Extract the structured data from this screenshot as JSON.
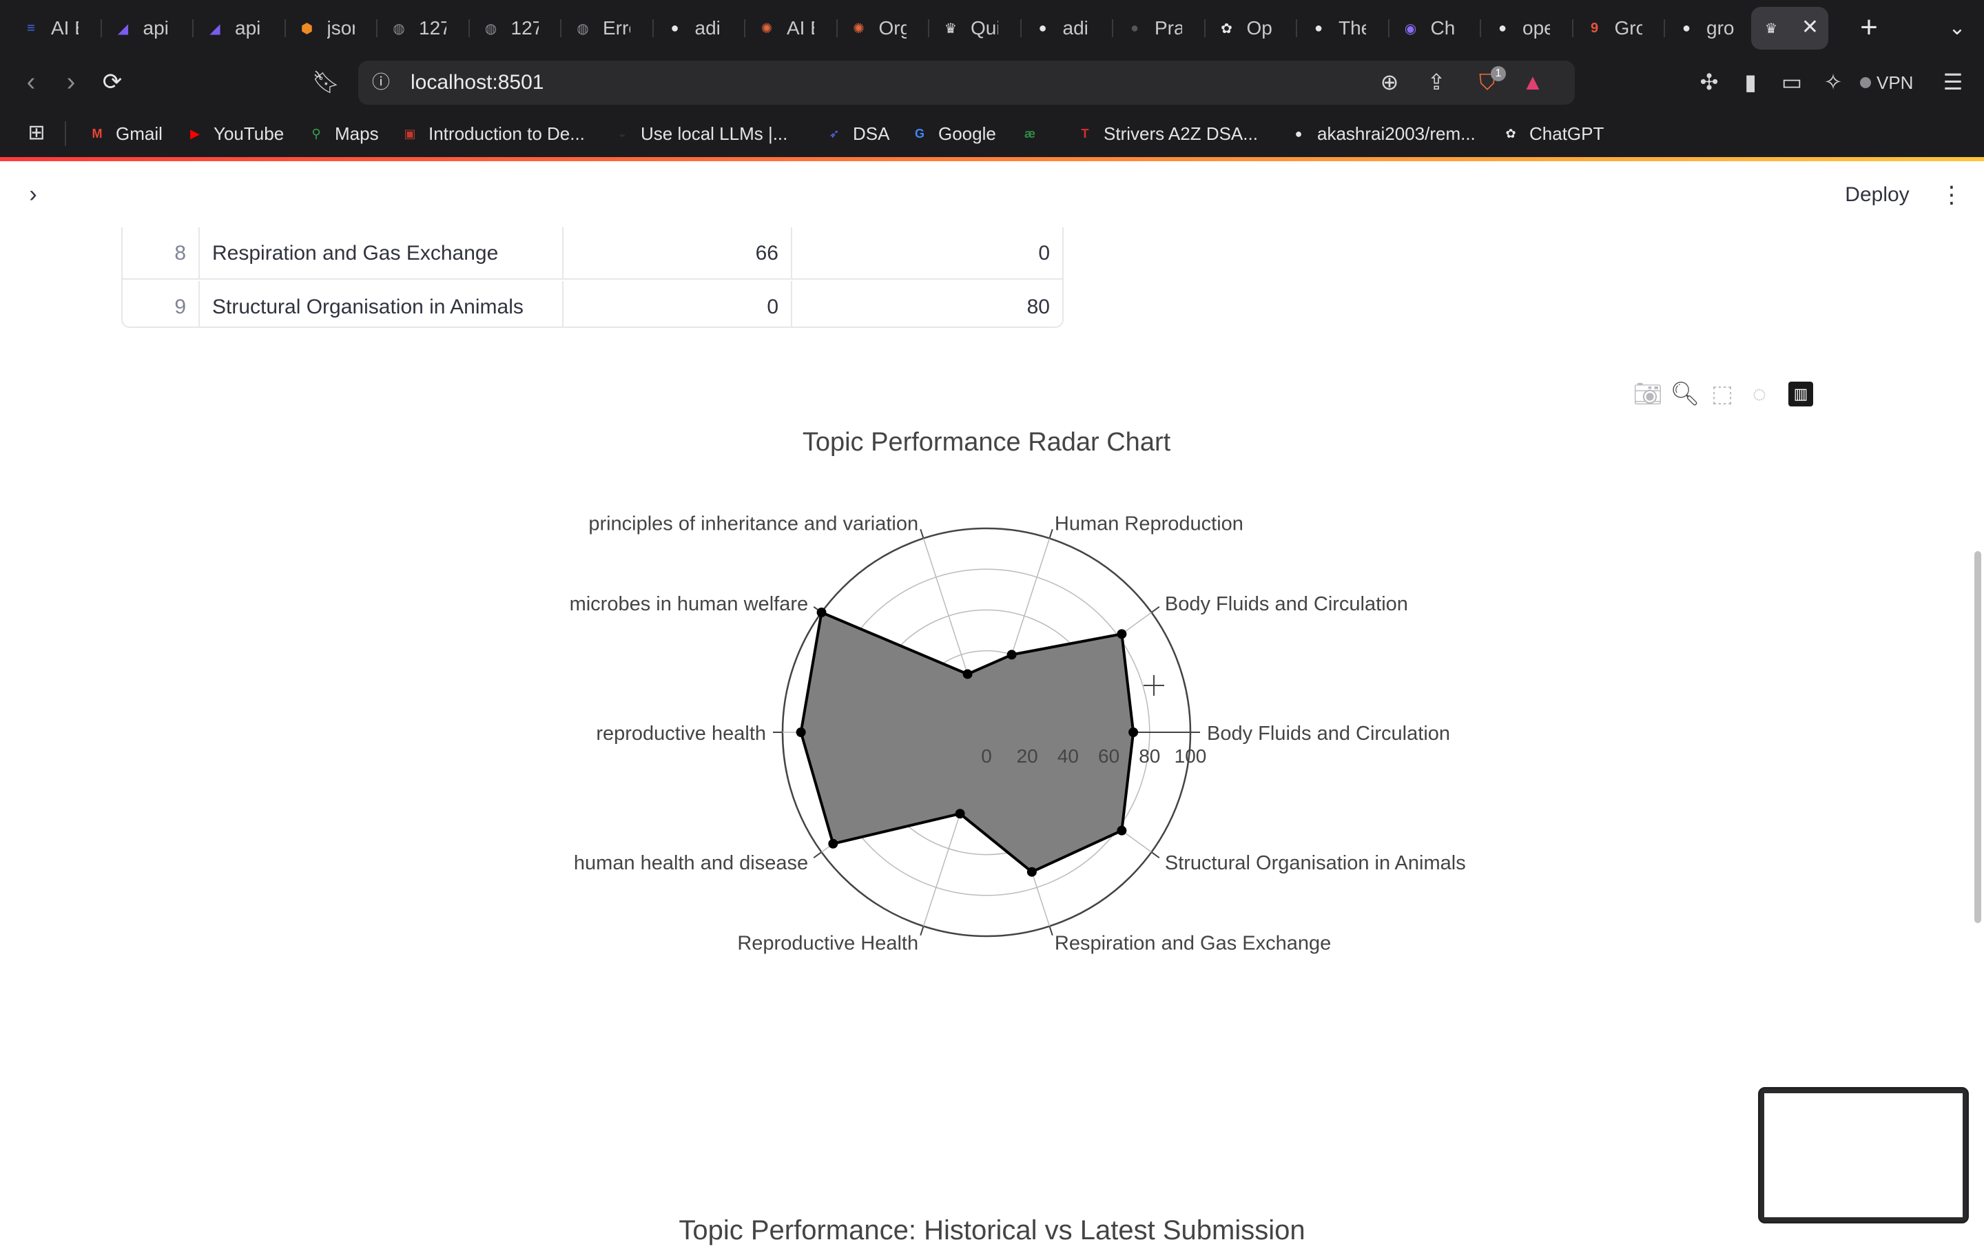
{
  "browser": {
    "tabs": [
      {
        "label": "AI E",
        "icon": "docs-icon",
        "color": "#3a6df0"
      },
      {
        "label": "api",
        "icon": "stack-icon",
        "color": "#7b5cf0"
      },
      {
        "label": "api",
        "icon": "stack-icon",
        "color": "#7b5cf0"
      },
      {
        "label": "jsor",
        "icon": "hexagon-icon",
        "color": "#f08a24"
      },
      {
        "label": "127",
        "icon": "globe-icon",
        "color": "#8c8c90"
      },
      {
        "label": "127",
        "icon": "globe-icon",
        "color": "#8c8c90"
      },
      {
        "label": "Erro",
        "icon": "globe-icon",
        "color": "#8c8c90"
      },
      {
        "label": "adi",
        "icon": "github-icon",
        "color": "#e6e6e6"
      },
      {
        "label": "AI E",
        "icon": "sparkle-icon",
        "color": "#e2653b"
      },
      {
        "label": "Org",
        "icon": "sparkle-icon",
        "color": "#e2653b"
      },
      {
        "label": "Qui",
        "icon": "crown-icon",
        "color": "#e6e6e6"
      },
      {
        "label": "adi",
        "icon": "github-icon",
        "color": "#e6e6e6"
      },
      {
        "label": "Pra",
        "icon": "github-icon",
        "color": "#555555"
      },
      {
        "label": "Op",
        "icon": "openai-icon",
        "color": "#e6e6e6"
      },
      {
        "label": "The",
        "icon": "github-icon",
        "color": "#e6e6e6"
      },
      {
        "label": "Ch",
        "icon": "chat-icon",
        "color": "#8b6cf0"
      },
      {
        "label": "ope",
        "icon": "github-icon",
        "color": "#e6e6e6"
      },
      {
        "label": "Gro",
        "icon": "badge-icon",
        "color": "#e8553b"
      },
      {
        "label": "gro",
        "icon": "github-icon",
        "color": "#e6e6e6"
      }
    ],
    "url": "localhost:8501",
    "shield_count": "1",
    "vpn_label": "VPN",
    "bookmarks": [
      {
        "label": "Gmail",
        "icon": "gmail-icon",
        "color": "#ea4335"
      },
      {
        "label": "YouTube",
        "icon": "youtube-icon",
        "color": "#ff0000"
      },
      {
        "label": "Maps",
        "icon": "maps-icon",
        "color": "#34a853"
      },
      {
        "label": "Introduction to De...",
        "icon": "course-icon",
        "color": "#c0392b"
      },
      {
        "label": "Use local LLMs |...",
        "icon": "llm-icon",
        "color": "#2d2d2d"
      },
      {
        "label": "DSA",
        "icon": "rocket-icon",
        "color": "#5a6cf0"
      },
      {
        "label": "Google",
        "icon": "google-icon",
        "color": "#4285f4"
      },
      {
        "label": "",
        "icon": "gfg-icon",
        "color": "#2f8d46"
      },
      {
        "label": "Strivers A2Z DSA...",
        "icon": "tuf-icon",
        "color": "#d62d2d"
      },
      {
        "label": "akashrai2003/rem...",
        "icon": "github-icon",
        "color": "#e6e6e6"
      },
      {
        "label": "ChatGPT",
        "icon": "openai-icon",
        "color": "#e6e6e6"
      }
    ]
  },
  "app": {
    "deploy_label": "Deploy",
    "table_rows": [
      {
        "index": "8",
        "topic": "Respiration and Gas Exchange",
        "v1": "66",
        "v2": "0"
      },
      {
        "index": "9",
        "topic": "Structural Organisation in Animals",
        "v1": "0",
        "v2": "80"
      }
    ],
    "next_chart_title": "Topic Performance: Historical vs Latest Submission"
  },
  "chart_data": {
    "type": "radar",
    "title": "Topic Performance Radar Chart",
    "radial_range": [
      0,
      100
    ],
    "radial_ticks": [
      "0",
      "20",
      "40",
      "60",
      "80",
      "100"
    ],
    "categories": [
      "Body Fluids and Circulation",
      "Body Fluids and Circulation",
      "Human Reproduction",
      "principles of inheritance and variation",
      "microbes in human welfare",
      "reproductive health",
      "human health and disease",
      "Reproductive Health",
      "Respiration and Gas Exchange",
      "Structural Organisation in Animals"
    ],
    "values": [
      72,
      82,
      40,
      30,
      100,
      91,
      93,
      42,
      72,
      82
    ],
    "fill_color": "#808080",
    "line_color": "#000000"
  }
}
